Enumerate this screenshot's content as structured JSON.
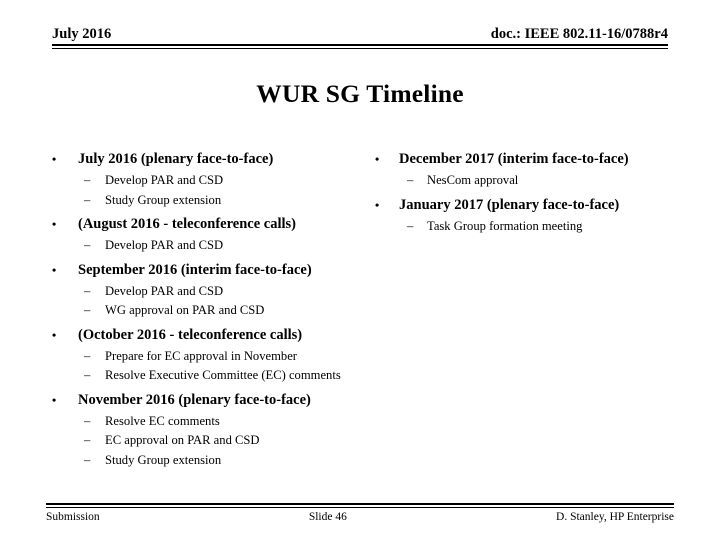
{
  "header": {
    "left": "July 2016",
    "right": "doc.: IEEE 802.11-16/0788r4"
  },
  "title": "WUR SG Timeline",
  "bullet_marker": "•",
  "dash_marker": "–",
  "left_column": [
    {
      "heading": "July 2016 (plenary face-to-face)",
      "items": [
        "Develop PAR and CSD",
        "Study Group extension"
      ]
    },
    {
      "heading": "(August 2016 - teleconference calls)",
      "items": [
        "Develop PAR and CSD"
      ]
    },
    {
      "heading": "September 2016 (interim face-to-face)",
      "items": [
        "Develop PAR and CSD",
        "WG approval on PAR and CSD"
      ]
    },
    {
      "heading": "(October 2016 - teleconference calls)",
      "items": [
        "Prepare for EC approval in November",
        "Resolve Executive Committee (EC) comments"
      ]
    },
    {
      "heading": "November 2016 (plenary face-to-face)",
      "items": [
        "Resolve EC comments",
        "EC approval on PAR and CSD",
        "Study Group extension"
      ]
    }
  ],
  "right_column": [
    {
      "heading": "December 2017 (interim face-to-face)",
      "items": [
        "NesCom approval"
      ]
    },
    {
      "heading": "January 2017 (plenary face-to-face)",
      "items": [
        "Task Group formation meeting"
      ]
    }
  ],
  "footer": {
    "left": "Submission",
    "center": "Slide 46",
    "right": "D. Stanley, HP Enterprise"
  }
}
